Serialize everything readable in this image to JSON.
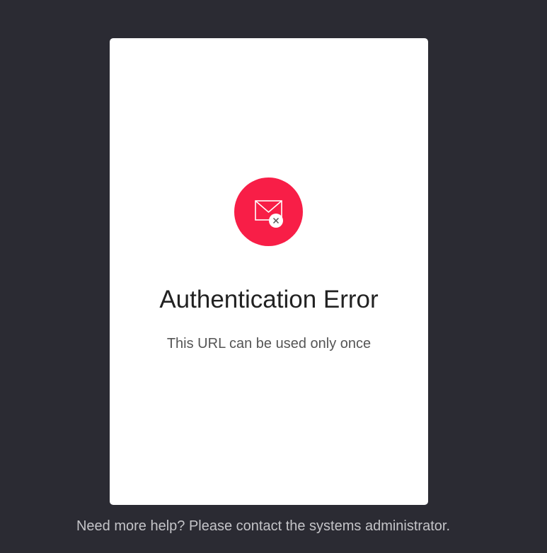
{
  "card": {
    "title": "Authentication Error",
    "message": "This URL can be used only once",
    "icon": "envelope-error-icon"
  },
  "footer": {
    "help_text": "Need more help? Please contact the systems administrator."
  },
  "colors": {
    "background": "#2b2b33",
    "card": "#ffffff",
    "accent": "#f81e47"
  }
}
